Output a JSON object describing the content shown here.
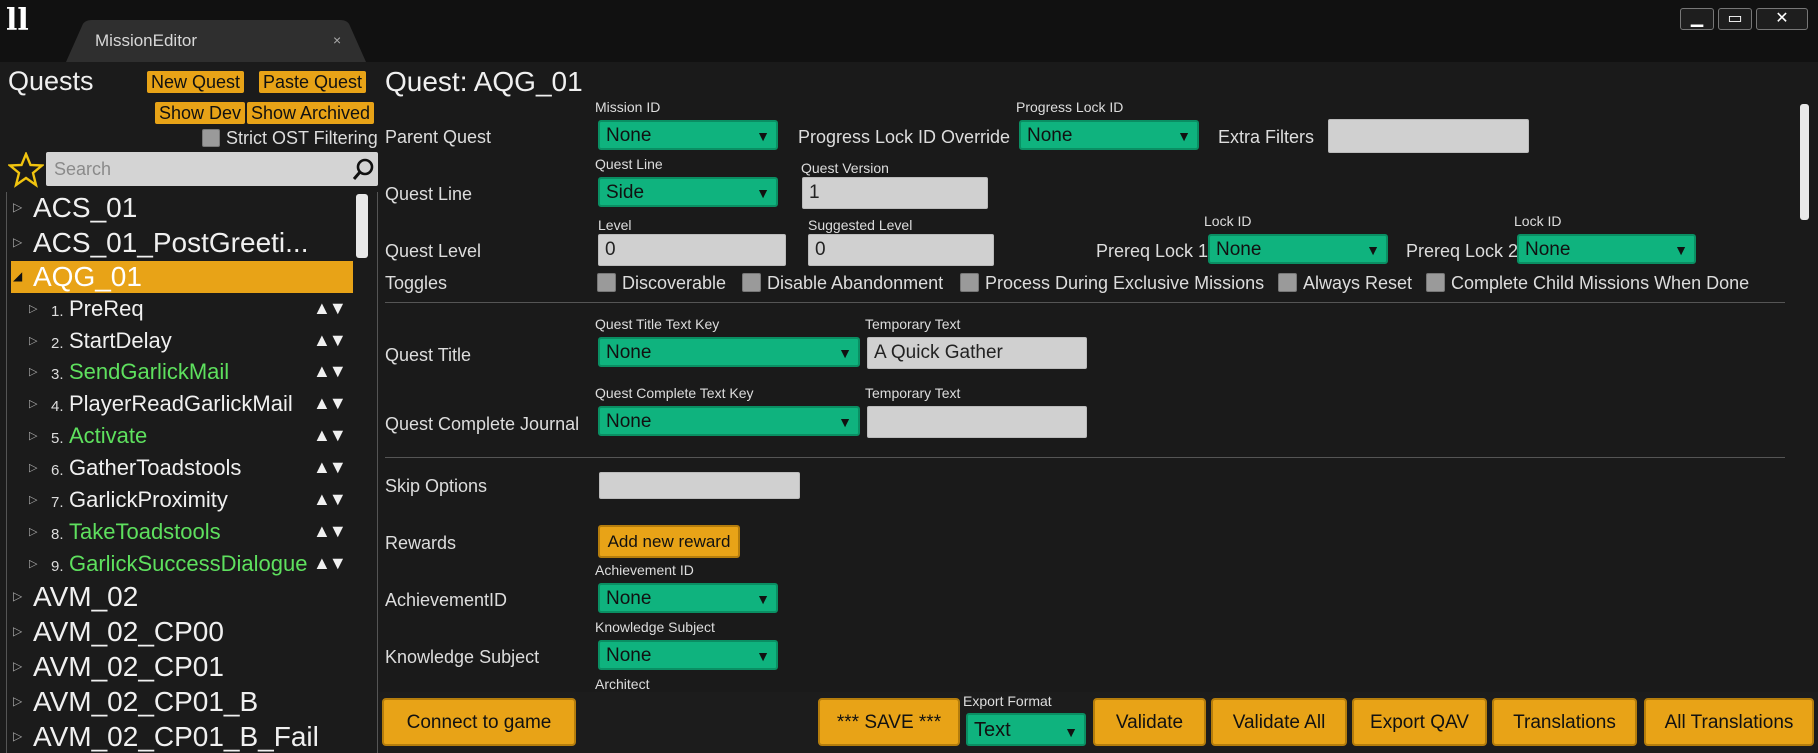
{
  "window": {
    "tab_title": "MissionEditor",
    "tab_close": "×",
    "controls": {
      "minimize": "▁",
      "maximize": "▭",
      "close": "✕"
    }
  },
  "sidebar": {
    "title": "Quests",
    "new_quest": "New Quest",
    "paste_quest": "Paste Quest",
    "show_dev": "Show Dev",
    "show_archived": "Show Archived",
    "strict_filter": "Strict OST Filtering",
    "search_placeholder": "Search",
    "top_items": [
      "ACS_01",
      "ACS_01_PostGreeti..."
    ],
    "selected": "AQG_01",
    "sub_items": [
      {
        "num": "1.",
        "label": "PreReq",
        "color": "#f0f0f0"
      },
      {
        "num": "2.",
        "label": "StartDelay",
        "color": "#f0f0f0"
      },
      {
        "num": "3.",
        "label": "SendGarlickMail",
        "color": "#5ee05e"
      },
      {
        "num": "4.",
        "label": "PlayerReadGarlickMail",
        "color": "#f0f0f0"
      },
      {
        "num": "5.",
        "label": "Activate",
        "color": "#5ee05e"
      },
      {
        "num": "6.",
        "label": "GatherToadstools",
        "color": "#f0f0f0"
      },
      {
        "num": "7.",
        "label": "GarlickProximity",
        "color": "#f0f0f0"
      },
      {
        "num": "8.",
        "label": "TakeToadstools",
        "color": "#5ee05e"
      },
      {
        "num": "9.",
        "label": "GarlickSuccessDialogue",
        "color": "#5ee05e"
      }
    ],
    "bottom_items": [
      "AVM_02",
      "AVM_02_CP00",
      "AVM_02_CP01",
      "AVM_02_CP01_B",
      "AVM_02_CP01_B_Fail"
    ]
  },
  "main": {
    "heading": "Quest: AQG_01",
    "parent_quest": "Parent Quest",
    "mission_id_label": "Mission ID",
    "mission_id": "None",
    "progress_lock_override": "Progress Lock ID Override",
    "progress_lock_label": "Progress Lock ID",
    "progress_lock": "None",
    "extra_filters": "Extra Filters",
    "quest_line": "Quest Line",
    "quest_line_small": "Quest Line",
    "quest_line_value": "Side",
    "quest_version_label": "Quest Version",
    "quest_version": "1",
    "quest_level": "Quest Level",
    "level_label": "Level",
    "level": "0",
    "suggested_level_label": "Suggested Level",
    "suggested_level": "0",
    "lock_id_label": "Lock ID",
    "prereq_lock_1": "Prereq Lock 1",
    "prereq_lock_1_value": "None",
    "prereq_lock_2": "Prereq Lock 2",
    "prereq_lock_2_value": "None",
    "toggles": "Toggles",
    "toggle_items": [
      "Discoverable",
      "Disable Abandonment",
      "Process During Exclusive Missions",
      "Always Reset",
      "Complete Child Missions When Done"
    ],
    "quest_title": "Quest Title",
    "quest_title_key_label": "Quest Title Text Key",
    "quest_title_key": "None",
    "temp_text_label": "Temporary Text",
    "quest_title_temp": "A Quick Gather",
    "quest_complete_journal": "Quest Complete Journal",
    "quest_complete_key_label": "Quest Complete Text Key",
    "quest_complete_key": "None",
    "skip_options": "Skip Options",
    "rewards": "Rewards",
    "add_reward": "Add new reward",
    "achievement_label": "AchievementID",
    "achievement_small": "Achievement ID",
    "achievement": "None",
    "knowledge_label": "Knowledge Subject",
    "knowledge_small": "Knowledge Subject",
    "knowledge": "None",
    "architect_small": "Architect"
  },
  "bottom": {
    "connect": "Connect to game",
    "save": "*** SAVE ***",
    "export_format_label": "Export Format",
    "export_format": "Text",
    "validate": "Validate",
    "validate_all": "Validate All",
    "export_qav": "Export QAV",
    "translations": "Translations",
    "all_translations": "All Translations"
  },
  "icons": {
    "favorite": "star-icon",
    "search": "search-icon",
    "dropdown": "dropdown-arrow-icon",
    "expand": "expand-arrow-icon"
  },
  "colors": {
    "accent": "#e8a317",
    "dropdown": "#0fb37e",
    "highlight_text": "#5ee05e"
  }
}
